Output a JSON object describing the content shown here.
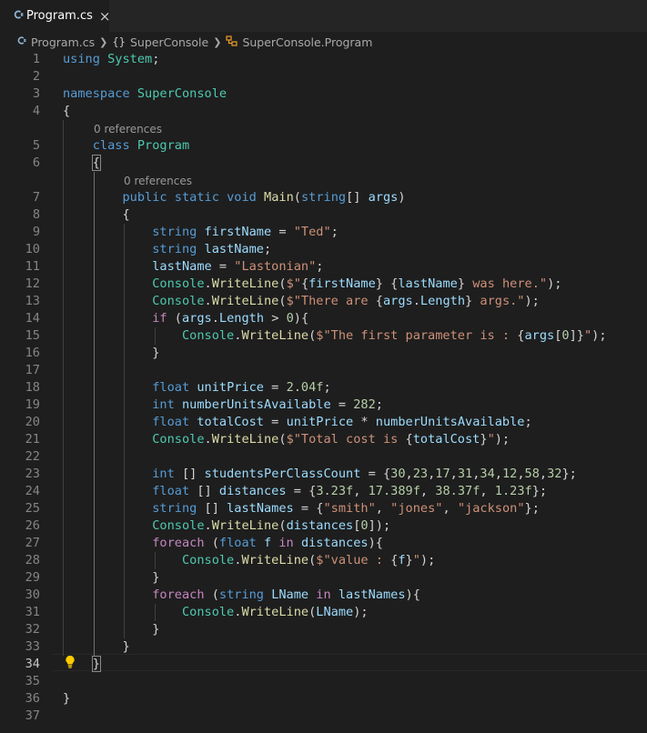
{
  "tab": {
    "icon": "C#",
    "label": "Program.cs",
    "close": "×"
  },
  "breadcrumb": {
    "file": "Program.cs",
    "namespace_icon": "{}",
    "namespace": "SuperConsole",
    "class": "SuperConsole.Program"
  },
  "codelens": {
    "class_refs": "0 references",
    "main_refs": "0 references"
  },
  "lines": [
    [
      [
        "kw",
        "using"
      ],
      [
        "pl",
        " "
      ],
      [
        "ty",
        "System"
      ],
      [
        "pl",
        ";"
      ]
    ],
    [],
    [
      [
        "kw",
        "namespace"
      ],
      [
        "pl",
        " "
      ],
      [
        "ty",
        "SuperConsole"
      ]
    ],
    [
      [
        "pl",
        "{"
      ]
    ],
    [
      [
        "pl",
        "    "
      ],
      [
        "kw",
        "class"
      ],
      [
        "pl",
        " "
      ],
      [
        "ty",
        "Program"
      ]
    ],
    [
      [
        "pl",
        "    "
      ],
      [
        "br",
        "{"
      ]
    ],
    [
      [
        "pl",
        "        "
      ],
      [
        "kw",
        "public"
      ],
      [
        "pl",
        " "
      ],
      [
        "kw",
        "static"
      ],
      [
        "pl",
        " "
      ],
      [
        "kw",
        "void"
      ],
      [
        "pl",
        " "
      ],
      [
        "fn",
        "Main"
      ],
      [
        "pl",
        "("
      ],
      [
        "kw",
        "string"
      ],
      [
        "pl",
        "[] "
      ],
      [
        "vr",
        "args"
      ],
      [
        "pl",
        ")"
      ]
    ],
    [
      [
        "pl",
        "        {"
      ]
    ],
    [
      [
        "pl",
        "            "
      ],
      [
        "kw",
        "string"
      ],
      [
        "pl",
        " "
      ],
      [
        "vr",
        "firstName"
      ],
      [
        "pl",
        " = "
      ],
      [
        "st",
        "\"Ted\""
      ],
      [
        "pl",
        ";"
      ]
    ],
    [
      [
        "pl",
        "            "
      ],
      [
        "kw",
        "string"
      ],
      [
        "pl",
        " "
      ],
      [
        "vr",
        "lastName"
      ],
      [
        "pl",
        ";"
      ]
    ],
    [
      [
        "pl",
        "            "
      ],
      [
        "vr",
        "lastName"
      ],
      [
        "pl",
        " = "
      ],
      [
        "st",
        "\"Lastonian\""
      ],
      [
        "pl",
        ";"
      ]
    ],
    [
      [
        "pl",
        "            "
      ],
      [
        "ty",
        "Console"
      ],
      [
        "pl",
        "."
      ],
      [
        "fn",
        "WriteLine"
      ],
      [
        "pl",
        "("
      ],
      [
        "st",
        "$\""
      ],
      [
        "pl",
        "{"
      ],
      [
        "vr",
        "firstName"
      ],
      [
        "pl",
        "}"
      ],
      [
        "st",
        " "
      ],
      [
        "pl",
        "{"
      ],
      [
        "vr",
        "lastName"
      ],
      [
        "pl",
        "}"
      ],
      [
        "st",
        " was here.\""
      ],
      [
        "pl",
        ");"
      ]
    ],
    [
      [
        "pl",
        "            "
      ],
      [
        "ty",
        "Console"
      ],
      [
        "pl",
        "."
      ],
      [
        "fn",
        "WriteLine"
      ],
      [
        "pl",
        "("
      ],
      [
        "st",
        "$\"There are "
      ],
      [
        "pl",
        "{"
      ],
      [
        "vr",
        "args"
      ],
      [
        "pl",
        "."
      ],
      [
        "vr",
        "Length"
      ],
      [
        "pl",
        "}"
      ],
      [
        "st",
        " args.\""
      ],
      [
        "pl",
        ");"
      ]
    ],
    [
      [
        "pl",
        "            "
      ],
      [
        "ctl",
        "if"
      ],
      [
        "pl",
        " ("
      ],
      [
        "vr",
        "args"
      ],
      [
        "pl",
        "."
      ],
      [
        "vr",
        "Length"
      ],
      [
        "pl",
        " > "
      ],
      [
        "nm",
        "0"
      ],
      [
        "pl",
        "){"
      ]
    ],
    [
      [
        "pl",
        "                "
      ],
      [
        "ty",
        "Console"
      ],
      [
        "pl",
        "."
      ],
      [
        "fn",
        "WriteLine"
      ],
      [
        "pl",
        "("
      ],
      [
        "st",
        "$\"The first parameter is : "
      ],
      [
        "pl",
        "{"
      ],
      [
        "vr",
        "args"
      ],
      [
        "pl",
        "["
      ],
      [
        "nm",
        "0"
      ],
      [
        "pl",
        "]}"
      ],
      [
        "st",
        "\""
      ],
      [
        "pl",
        ");"
      ]
    ],
    [
      [
        "pl",
        "            }"
      ]
    ],
    [],
    [
      [
        "pl",
        "            "
      ],
      [
        "kw",
        "float"
      ],
      [
        "pl",
        " "
      ],
      [
        "vr",
        "unitPrice"
      ],
      [
        "pl",
        " = "
      ],
      [
        "nm",
        "2.04f"
      ],
      [
        "pl",
        ";"
      ]
    ],
    [
      [
        "pl",
        "            "
      ],
      [
        "kw",
        "int"
      ],
      [
        "pl",
        " "
      ],
      [
        "vr",
        "numberUnitsAvailable"
      ],
      [
        "pl",
        " = "
      ],
      [
        "nm",
        "282"
      ],
      [
        "pl",
        ";"
      ]
    ],
    [
      [
        "pl",
        "            "
      ],
      [
        "kw",
        "float"
      ],
      [
        "pl",
        " "
      ],
      [
        "vr",
        "totalCost"
      ],
      [
        "pl",
        " = "
      ],
      [
        "vr",
        "unitPrice"
      ],
      [
        "pl",
        " * "
      ],
      [
        "vr",
        "numberUnitsAvailable"
      ],
      [
        "pl",
        ";"
      ]
    ],
    [
      [
        "pl",
        "            "
      ],
      [
        "ty",
        "Console"
      ],
      [
        "pl",
        "."
      ],
      [
        "fn",
        "WriteLine"
      ],
      [
        "pl",
        "("
      ],
      [
        "st",
        "$\"Total cost is "
      ],
      [
        "pl",
        "{"
      ],
      [
        "vr",
        "totalCost"
      ],
      [
        "pl",
        "}"
      ],
      [
        "st",
        "\""
      ],
      [
        "pl",
        ");"
      ]
    ],
    [],
    [
      [
        "pl",
        "            "
      ],
      [
        "kw",
        "int"
      ],
      [
        "pl",
        " [] "
      ],
      [
        "vr",
        "studentsPerClassCount"
      ],
      [
        "pl",
        " = {"
      ],
      [
        "nm",
        "30"
      ],
      [
        "pl",
        ","
      ],
      [
        "nm",
        "23"
      ],
      [
        "pl",
        ","
      ],
      [
        "nm",
        "17"
      ],
      [
        "pl",
        ","
      ],
      [
        "nm",
        "31"
      ],
      [
        "pl",
        ","
      ],
      [
        "nm",
        "34"
      ],
      [
        "pl",
        ","
      ],
      [
        "nm",
        "12"
      ],
      [
        "pl",
        ","
      ],
      [
        "nm",
        "58"
      ],
      [
        "pl",
        ","
      ],
      [
        "nm",
        "32"
      ],
      [
        "pl",
        "};"
      ]
    ],
    [
      [
        "pl",
        "            "
      ],
      [
        "kw",
        "float"
      ],
      [
        "pl",
        " [] "
      ],
      [
        "vr",
        "distances"
      ],
      [
        "pl",
        " = {"
      ],
      [
        "nm",
        "3.23f"
      ],
      [
        "pl",
        ", "
      ],
      [
        "nm",
        "17.389f"
      ],
      [
        "pl",
        ", "
      ],
      [
        "nm",
        "38.37f"
      ],
      [
        "pl",
        ", "
      ],
      [
        "nm",
        "1.23f"
      ],
      [
        "pl",
        "};"
      ]
    ],
    [
      [
        "pl",
        "            "
      ],
      [
        "kw",
        "string"
      ],
      [
        "pl",
        " [] "
      ],
      [
        "vr",
        "lastNames"
      ],
      [
        "pl",
        " = {"
      ],
      [
        "st",
        "\"smith\""
      ],
      [
        "pl",
        ", "
      ],
      [
        "st",
        "\"jones\""
      ],
      [
        "pl",
        ", "
      ],
      [
        "st",
        "\"jackson\""
      ],
      [
        "pl",
        "};"
      ]
    ],
    [
      [
        "pl",
        "            "
      ],
      [
        "ty",
        "Console"
      ],
      [
        "pl",
        "."
      ],
      [
        "fn",
        "WriteLine"
      ],
      [
        "pl",
        "("
      ],
      [
        "vr",
        "distances"
      ],
      [
        "pl",
        "["
      ],
      [
        "nm",
        "0"
      ],
      [
        "pl",
        "]);"
      ]
    ],
    [
      [
        "pl",
        "            "
      ],
      [
        "ctl",
        "foreach"
      ],
      [
        "pl",
        " ("
      ],
      [
        "kw",
        "float"
      ],
      [
        "pl",
        " "
      ],
      [
        "vr",
        "f"
      ],
      [
        "pl",
        " "
      ],
      [
        "ctl",
        "in"
      ],
      [
        "pl",
        " "
      ],
      [
        "vr",
        "distances"
      ],
      [
        "pl",
        "){"
      ]
    ],
    [
      [
        "pl",
        "                "
      ],
      [
        "ty",
        "Console"
      ],
      [
        "pl",
        "."
      ],
      [
        "fn",
        "WriteLine"
      ],
      [
        "pl",
        "("
      ],
      [
        "st",
        "$\"value : "
      ],
      [
        "pl",
        "{"
      ],
      [
        "vr",
        "f"
      ],
      [
        "pl",
        "}"
      ],
      [
        "st",
        "\""
      ],
      [
        "pl",
        ");"
      ]
    ],
    [
      [
        "pl",
        "            }"
      ]
    ],
    [
      [
        "pl",
        "            "
      ],
      [
        "ctl",
        "foreach"
      ],
      [
        "pl",
        " ("
      ],
      [
        "kw",
        "string"
      ],
      [
        "pl",
        " "
      ],
      [
        "vr",
        "LName"
      ],
      [
        "pl",
        " "
      ],
      [
        "ctl",
        "in"
      ],
      [
        "pl",
        " "
      ],
      [
        "vr",
        "lastNames"
      ],
      [
        "pl",
        "){"
      ]
    ],
    [
      [
        "pl",
        "                "
      ],
      [
        "ty",
        "Console"
      ],
      [
        "pl",
        "."
      ],
      [
        "fn",
        "WriteLine"
      ],
      [
        "pl",
        "("
      ],
      [
        "vr",
        "LName"
      ],
      [
        "pl",
        ");"
      ]
    ],
    [
      [
        "pl",
        "            }"
      ]
    ],
    [
      [
        "pl",
        "        }"
      ]
    ],
    [
      [
        "pl",
        "    "
      ],
      [
        "br",
        "}"
      ]
    ],
    [],
    [
      [
        "pl",
        "}"
      ]
    ],
    []
  ]
}
